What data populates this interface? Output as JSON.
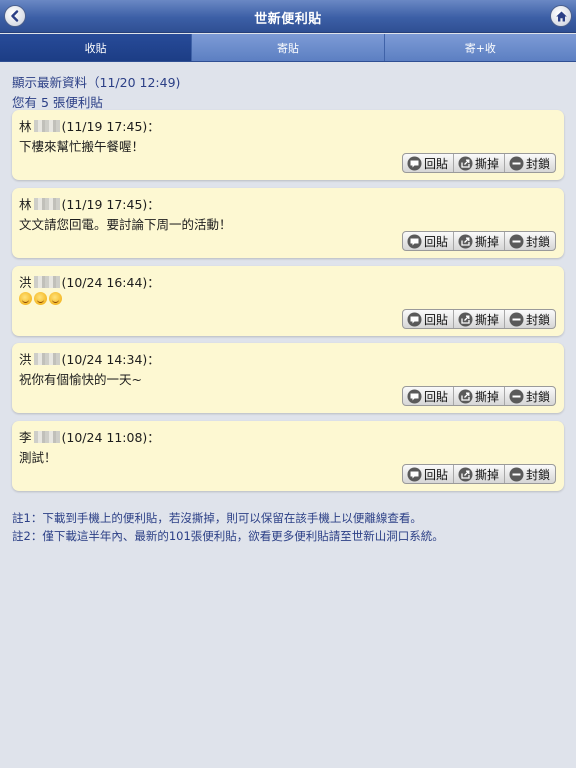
{
  "header": {
    "title": "世新便利貼"
  },
  "tabs": [
    {
      "label": "收貼",
      "active": true
    },
    {
      "label": "寄貼",
      "active": false
    },
    {
      "label": "寄+收",
      "active": false
    }
  ],
  "info": {
    "updated": "顯示最新資料（11/20 12:49)",
    "count": "您有 5 張便利貼"
  },
  "actions": {
    "reply": "回貼",
    "tear": "撕掉",
    "block": "封鎖"
  },
  "notes": [
    {
      "surname": "林",
      "time": "(11/19 17:45)：",
      "message": "下樓來幫忙搬午餐喔！"
    },
    {
      "surname": "林",
      "time": "(11/19 17:45)：",
      "message": "文文請您回電。要討論下周一的活動！"
    },
    {
      "surname": "洪",
      "time": "(10/24 16:44)：",
      "message": ""
    },
    {
      "surname": "洪",
      "time": "(10/24 14:34)：",
      "message": "祝你有個愉快的一天~"
    },
    {
      "surname": "李",
      "time": "(10/24 11:08)：",
      "message": "測試！"
    }
  ],
  "footnotes": [
    "註1：下載到手機上的便利貼，若沒撕掉，則可以保留在該手機上以便離線查看。",
    "註2：僅下載這半年內、最新的101張便利貼，欲看更多便利貼請至世新山洞口系統。"
  ],
  "colors": {
    "header": "#3c5fa6",
    "active_tab": "#1c3d85",
    "tab": "#6a8ccb",
    "note_bg": "#fdf8d2",
    "info_text": "#2b3f86"
  },
  "icons": {
    "back": "chevron-left-icon",
    "home": "home-icon",
    "reply": "speech-bubble-icon",
    "tear": "share-icon",
    "block": "minus-circle-icon"
  }
}
